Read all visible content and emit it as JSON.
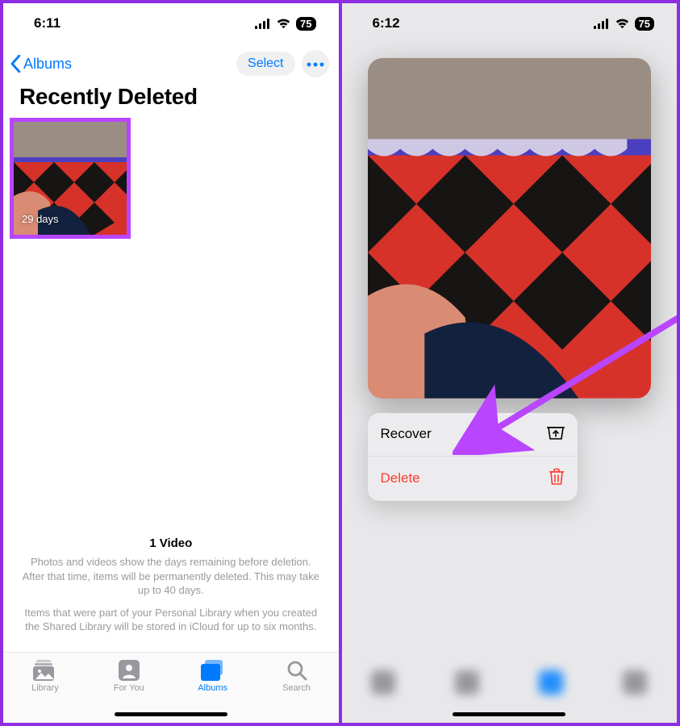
{
  "left": {
    "status": {
      "time": "6:11",
      "battery": "75"
    },
    "nav": {
      "back_label": "Albums",
      "select_label": "Select"
    },
    "title": "Recently Deleted",
    "thumb": {
      "days_label": "29 days"
    },
    "footer": {
      "count_label": "1 Video",
      "line1": "Photos and videos show the days remaining before deletion. After that time, items will be permanently deleted. This may take up to 40 days.",
      "line2": "Items that were part of your Personal Library when you created the Shared Library will be stored in iCloud for up to six months."
    },
    "tabs": [
      {
        "label": "Library"
      },
      {
        "label": "For You"
      },
      {
        "label": "Albums"
      },
      {
        "label": "Search"
      }
    ]
  },
  "right": {
    "status": {
      "time": "6:12",
      "battery": "75"
    },
    "menu": {
      "recover_label": "Recover",
      "delete_label": "Delete"
    }
  }
}
